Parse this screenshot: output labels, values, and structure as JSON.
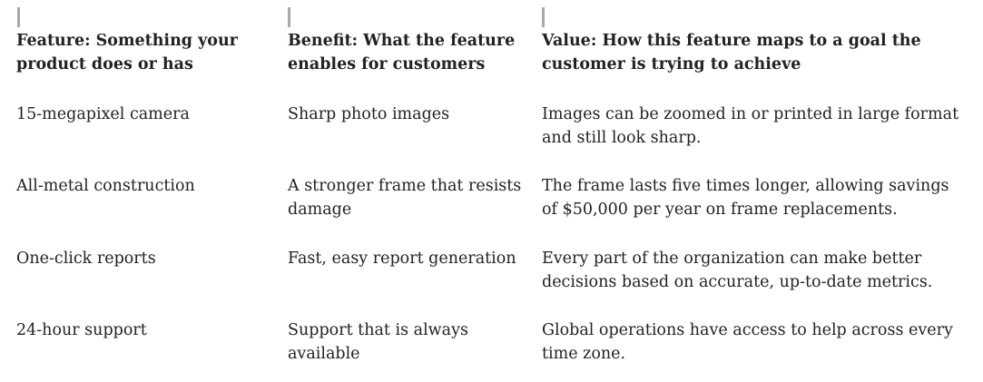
{
  "headers": {
    "feature": " Feature: Something your\nproduct does or has",
    "benefit": " Benefit: What the feature\nenables for customers",
    "value": " Value: How this feature maps to a goal the\ncustomer is trying to achieve"
  },
  "rows": [
    {
      "feature": " 15-megapixel camera",
      "benefit": " Sharp photo images",
      "value": " Images can be zoomed in or printed in large format\nand still look sharp."
    },
    {
      "feature": " All-metal construction",
      "benefit": " A stronger frame that resists\ndamage",
      "value": " The frame lasts five times longer, allowing savings\nof $50,000 per year on frame replacements."
    },
    {
      "feature": " One-click reports",
      "benefit": " Fast, easy report generation",
      "value": " Every part of the organization can make better\ndecisions based on accurate, up-to-date metrics."
    },
    {
      "feature": " 24-hour support",
      "benefit": " Support that is always\navailable",
      "value": " Global operations have access to help across every\ntime zone."
    }
  ]
}
